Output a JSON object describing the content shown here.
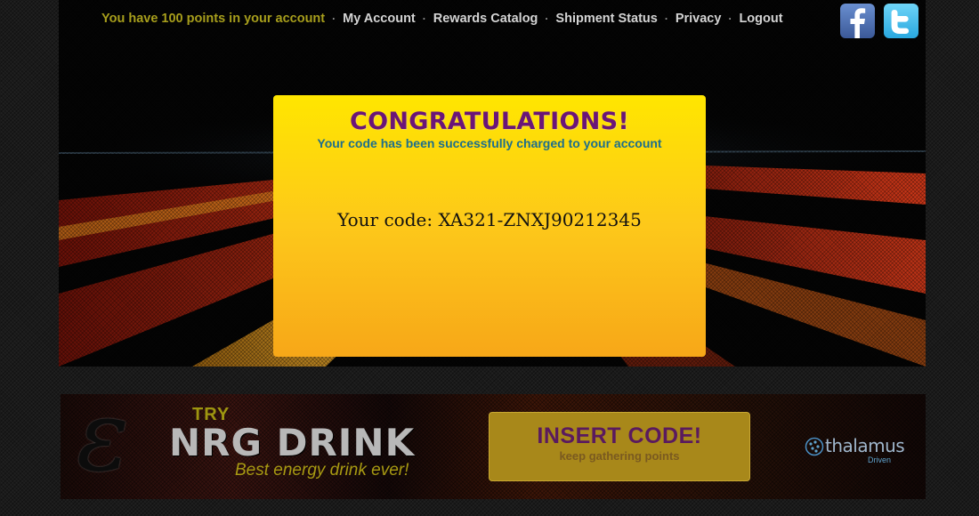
{
  "header": {
    "points_text": "You have 100 points in your account",
    "separator": "·",
    "nav": [
      "My Account",
      "Rewards Catalog",
      "Shipment Status",
      "Privacy",
      "Logout"
    ],
    "social": [
      "facebook-icon",
      "twitter-icon"
    ]
  },
  "modal": {
    "title": "CONGRATULATIONS!",
    "subtitle": "Your code has been successfully charged to your account",
    "code_line": "Your code: XA321-ZNXJ90212345"
  },
  "banner": {
    "try": "TRY",
    "brand": "NRG DRINK",
    "tagline": "Best energy drink ever!",
    "insert_label": "INSERT CODE!",
    "insert_sub": "keep gathering points",
    "sponsor_name": "thalamus",
    "sponsor_sub": "Driven"
  },
  "colors": {
    "modal_top": "#ffe600",
    "modal_bottom": "#f7a718",
    "title": "#6a1578",
    "subtitle": "#1d6e8c",
    "points": "#a79e1c"
  }
}
